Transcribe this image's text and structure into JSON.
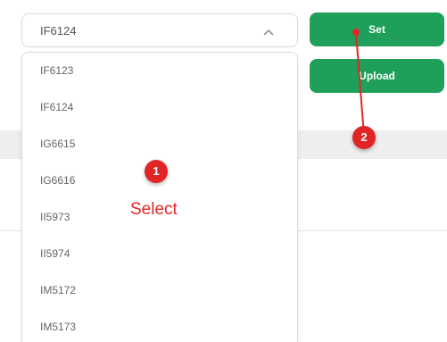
{
  "select": {
    "value": "IF6124",
    "chevron_icon": "chevron-up-icon"
  },
  "dropdown": {
    "options": [
      "IF6123",
      "IF6124",
      "IG6615",
      "IG6616",
      "II5973",
      "II5974",
      "IM5172",
      "IM5173"
    ]
  },
  "buttons": {
    "set_label": "Set",
    "upload_label": "Upload",
    "color": "#1fa05a"
  },
  "annotations": {
    "step1_number": "1",
    "step1_label": "Select",
    "step2_number": "2",
    "color": "#e12525"
  }
}
